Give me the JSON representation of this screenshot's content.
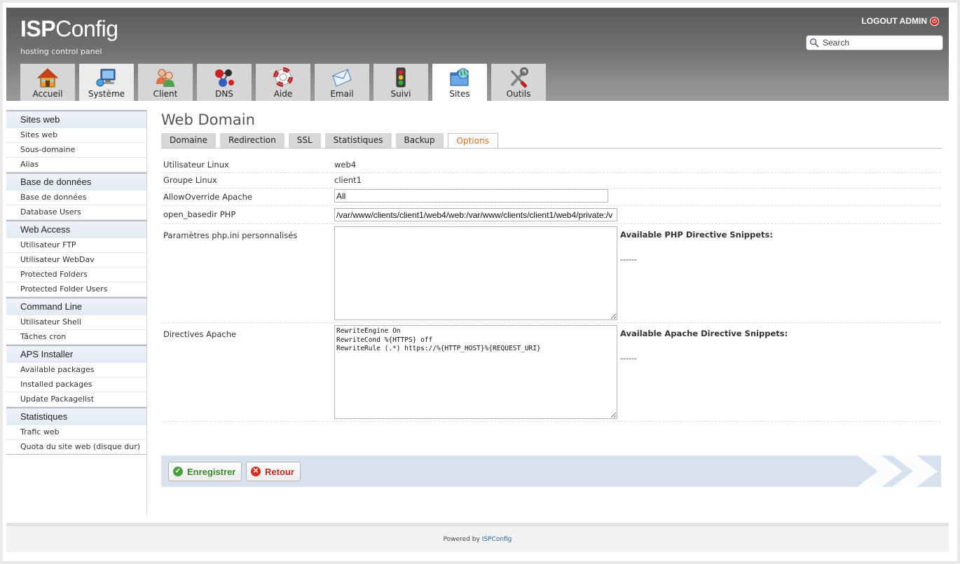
{
  "header": {
    "logo_bold": "ISP",
    "logo_rest": "Config",
    "subtitle": "hosting control panel",
    "logout_label": "LOGOUT ADMIN",
    "search_placeholder": "Search"
  },
  "nav": {
    "tabs": [
      {
        "label": "Accueil",
        "icon": "house-icon"
      },
      {
        "label": "Système",
        "icon": "computer-icon"
      },
      {
        "label": "Client",
        "icon": "users-icon"
      },
      {
        "label": "DNS",
        "icon": "network-icon"
      },
      {
        "label": "Aide",
        "icon": "lifebuoy-icon"
      },
      {
        "label": "Email",
        "icon": "envelope-icon"
      },
      {
        "label": "Suivi",
        "icon": "traffic-light-icon"
      },
      {
        "label": "Sites",
        "icon": "globe-folder-icon",
        "active": true
      },
      {
        "label": "Outils",
        "icon": "tools-icon"
      }
    ]
  },
  "sidebar": {
    "sections": [
      {
        "title": "Sites web",
        "items": [
          "Sites web",
          "Sous-domaine",
          "Alias"
        ]
      },
      {
        "title": "Base de données",
        "items": [
          "Base de données",
          "Database Users"
        ]
      },
      {
        "title": "Web Access",
        "items": [
          "Utilisateur FTP",
          "Utilisateur WebDav",
          "Protected Folders",
          "Protected Folder Users"
        ]
      },
      {
        "title": "Command Line",
        "items": [
          "Utilisateur Shell",
          "Tâches cron"
        ]
      },
      {
        "title": "APS Installer",
        "items": [
          "Available packages",
          "Installed packages",
          "Update Packagelist"
        ]
      },
      {
        "title": "Statistiques",
        "items": [
          "Trafic web",
          "Quota du site web (disque dur)"
        ]
      }
    ]
  },
  "main": {
    "title": "Web Domain",
    "tabs": [
      "Domaine",
      "Redirection",
      "SSL",
      "Statistiques",
      "Backup",
      "Options"
    ],
    "active_tab": "Options",
    "form": {
      "linux_user_label": "Utilisateur Linux",
      "linux_user_value": "web4",
      "linux_group_label": "Groupe Linux",
      "linux_group_value": "client1",
      "allow_override_label": "AllowOverride Apache",
      "allow_override_value": "All",
      "open_basedir_label": "open_basedir PHP",
      "open_basedir_value": "/var/www/clients/client1/web4/web:/var/www/clients/client1/web4/private:/v",
      "php_ini_label": "Paramètres php.ini personnalisés",
      "php_ini_value": "",
      "php_snippets_title": "Available PHP Directive Snippets:",
      "php_snippets_value": "------",
      "apache_label": "Directives Apache",
      "apache_value": "RewriteEngine On\nRewriteCond %{HTTPS} off\nRewriteRule (.*) https://%{HTTP_HOST}%{REQUEST_URI}",
      "apache_snippets_title": "Available Apache Directive Snippets:",
      "apache_snippets_value": "------"
    },
    "buttons": {
      "save_label": "Enregistrer",
      "back_label": "Retour"
    }
  },
  "footer": {
    "prefix": "Powered by",
    "brand": "ISPConfig"
  },
  "colors": {
    "header_dark": "#5a5a5a",
    "accent_orange": "#e06a1a",
    "sidebar_section_bg": "#e2eaf3",
    "button_bar_bg": "#d7e2ee",
    "save_green": "#3a8a2a",
    "back_red": "#c0281e"
  }
}
